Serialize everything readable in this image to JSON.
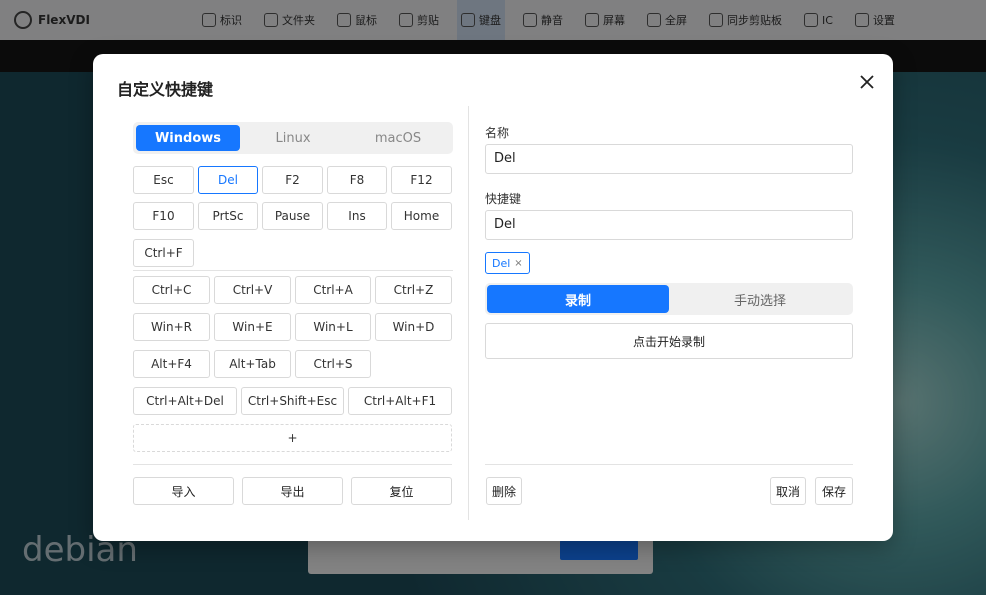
{
  "background": {
    "app_name": "FlexVDI",
    "nav_items": [
      "标识",
      "文件夹",
      "鼠标",
      "剪贴",
      "键盘",
      "静音",
      "屏幕",
      "全屏",
      "同步剪贴板",
      "IC",
      "设置",
      "全屏"
    ],
    "desktop_text": "debian"
  },
  "modal": {
    "title": "自定义快捷键",
    "os_tabs": [
      "Windows",
      "Linux",
      "macOS"
    ],
    "function_keys": [
      "Esc",
      "Del",
      "F2",
      "F8",
      "F12",
      "F10",
      "PrtSc",
      "Pause",
      "Ins",
      "Home",
      "Ctrl+F"
    ],
    "combo_keys": [
      "Ctrl+C",
      "Ctrl+V",
      "Ctrl+A",
      "Ctrl+Z",
      "Win+R",
      "Win+E",
      "Win+L",
      "Win+D",
      "Alt+F4",
      "Alt+Tab",
      "Ctrl+S"
    ],
    "triple_keys": [
      "Ctrl+Alt+Del",
      "Ctrl+Shift+Esc",
      "Ctrl+Alt+F1"
    ],
    "add_label": "+",
    "bottom_buttons": [
      "导入",
      "导出",
      "复位"
    ],
    "form": {
      "name_label": "名称",
      "name_value": "Del",
      "shortcut_label": "快捷键",
      "shortcut_value": "Del",
      "tag_value": "Del",
      "tag_close": "×",
      "mode_options": [
        "录制",
        "手动选择"
      ],
      "record_button": "点击开始录制",
      "delete_button": "删除",
      "cancel_button": "取消",
      "save_button": "保存"
    }
  },
  "colors": {
    "accent": "#1677ff"
  }
}
